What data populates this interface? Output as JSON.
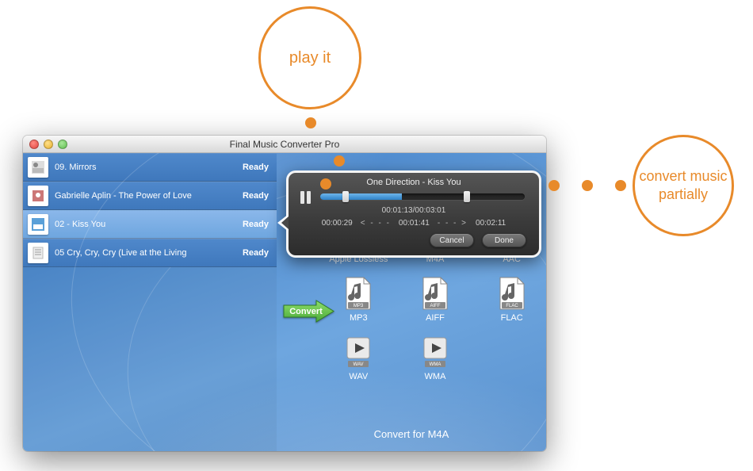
{
  "annotations": {
    "play": "play it",
    "partial": "convert music partially"
  },
  "window": {
    "title": "Final Music Converter Pro"
  },
  "tracks": [
    {
      "title": "09. Mirrors",
      "status": "Ready"
    },
    {
      "title": "Gabrielle Aplin - The Power of Love",
      "status": "Ready"
    },
    {
      "title": "02 - Kiss You",
      "status": "Ready"
    },
    {
      "title": "05 Cry, Cry, Cry (Live at the Living",
      "status": "Ready"
    }
  ],
  "formats": {
    "row1": [
      "Apple Lossless",
      "M4A",
      "AAC"
    ],
    "row2": [
      "MP3",
      "AIFF",
      "FLAC"
    ],
    "row3": [
      "WAV",
      "WMA"
    ],
    "tags": {
      "mp3": "MP3",
      "aiff": "AIFF",
      "flac": "FLAC",
      "wav": "WAV",
      "wma": "WMA"
    }
  },
  "convert_label": "Convert",
  "footer": "Convert for M4A",
  "player": {
    "title": "One Direction - Kiss You",
    "elapsed_total": "00:01:13/00:03:01",
    "start": "00:00:29",
    "mid": "00:01:41",
    "end": "00:02:11",
    "left_arrows": "< - - -",
    "right_arrows": "- - - >",
    "cancel": "Cancel",
    "done": "Done"
  }
}
